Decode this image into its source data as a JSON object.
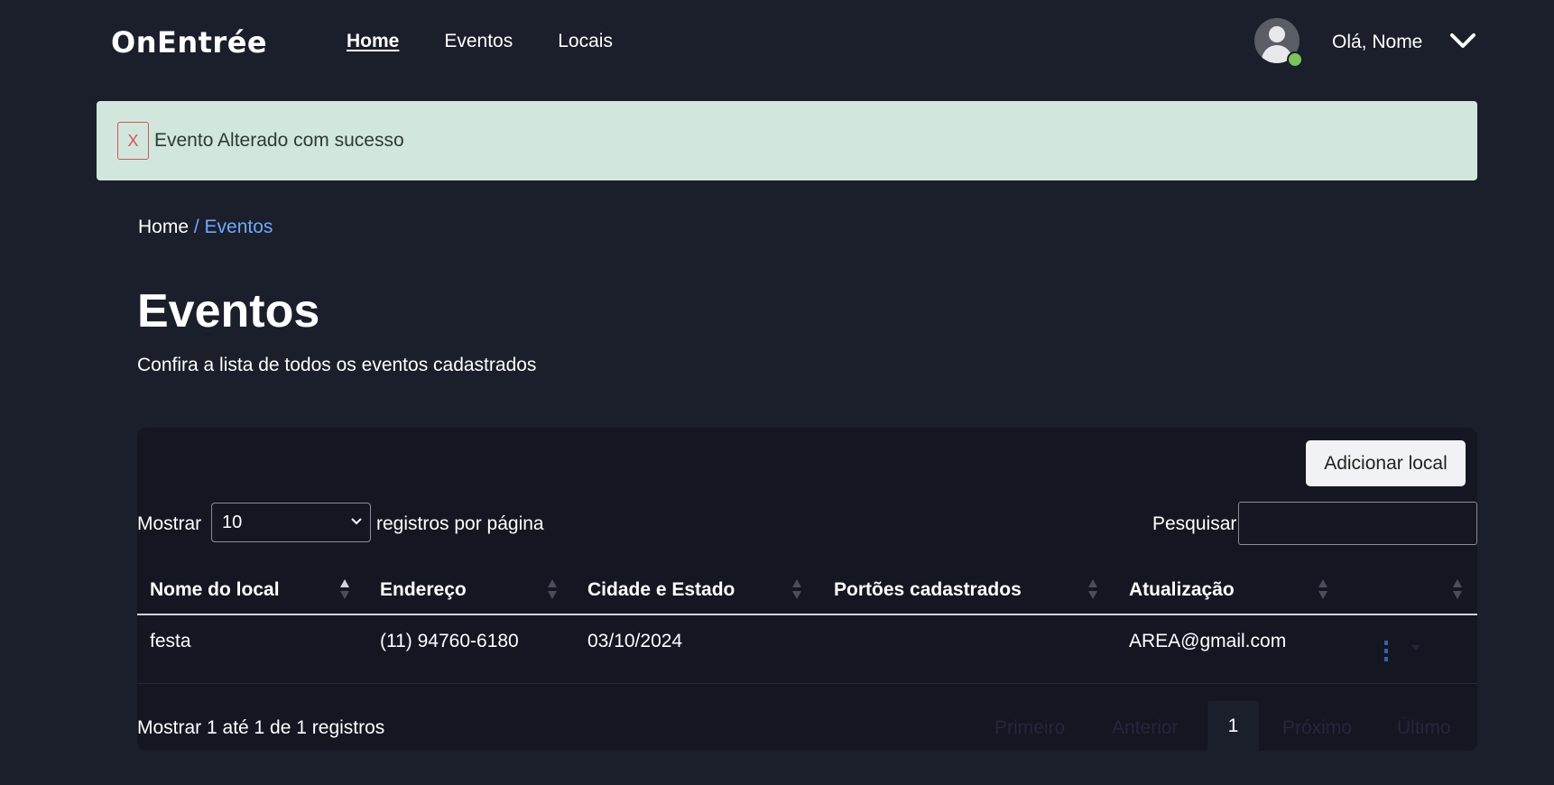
{
  "header": {
    "logo": "OnEntrée",
    "nav": [
      {
        "label": "Home",
        "active": true
      },
      {
        "label": "Eventos",
        "active": false
      },
      {
        "label": "Locais",
        "active": false
      }
    ],
    "greeting": "Olá, Nome",
    "status_color": "#7cc35a"
  },
  "alert": {
    "close_label": "X",
    "message": "Evento Alterado com sucesso",
    "background": "#d1e7dd"
  },
  "breadcrumb": {
    "home": "Home",
    "current": "/ Eventos"
  },
  "page": {
    "title": "Eventos",
    "subtitle": "Confira a lista de todos os eventos cadastrados"
  },
  "toolbar": {
    "add_button": "Adicionar local",
    "length_label": "Mostrar",
    "length_value": "10",
    "length_suffix": "registros por página",
    "search_label": "Pesquisar",
    "search_value": ""
  },
  "table": {
    "columns": [
      "Nome do local",
      "Endereço",
      "Cidade e Estado",
      "Portões cadastrados",
      "Atualização"
    ],
    "rows": [
      {
        "nome": "festa",
        "endereco": "(11) 94760-6180",
        "cidade": "03/10/2024",
        "portoes": "",
        "atualizacao": "AREA@gmail.com"
      }
    ]
  },
  "footer": {
    "info": "Mostrar 1 até 1 de 1 registros",
    "pagination": {
      "first": "Primeiro",
      "prev": "Anterior",
      "current": "1",
      "next": "Próximo",
      "last": "Último"
    }
  },
  "icons": {
    "avatar": "user-avatar-icon",
    "dropdown": "chevron-down-icon",
    "row_menu": "kebab-menu-icon"
  },
  "colors": {
    "background": "#1b1e2b",
    "card": "#141722",
    "link": "#6ea8fe"
  }
}
